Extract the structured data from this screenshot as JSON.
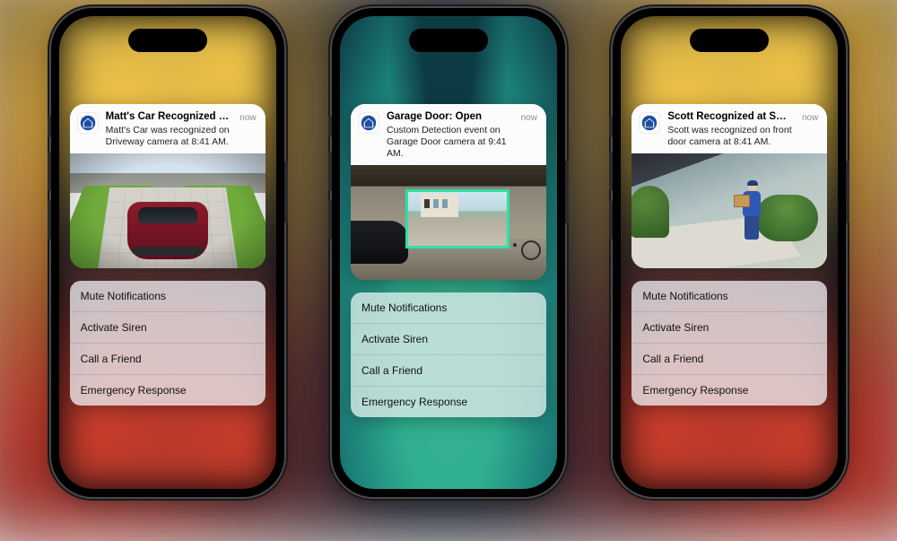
{
  "phones": [
    {
      "notif": {
        "title": "Matt's Car Recognized at Smith H…",
        "body": "Matt's Car was recognized on Driveway camera at 8:41 AM.",
        "when": "now"
      },
      "actions": [
        "Mute Notifications",
        "Activate Siren",
        "Call a Friend",
        "Emergency Response"
      ]
    },
    {
      "notif": {
        "title": "Garage Door: Open",
        "body": "Custom Detection event on Garage Door camera at 9:41 AM.",
        "when": "now"
      },
      "actions": [
        "Mute Notifications",
        "Activate Siren",
        "Call a Friend",
        "Emergency Response"
      ]
    },
    {
      "notif": {
        "title": "Scott Recognized at Smith Home",
        "body": "Scott was recognized on front door camera at 8:41 AM.",
        "when": "now"
      },
      "actions": [
        "Mute Notifications",
        "Activate Siren",
        "Call a Friend",
        "Emergency Response"
      ]
    }
  ]
}
